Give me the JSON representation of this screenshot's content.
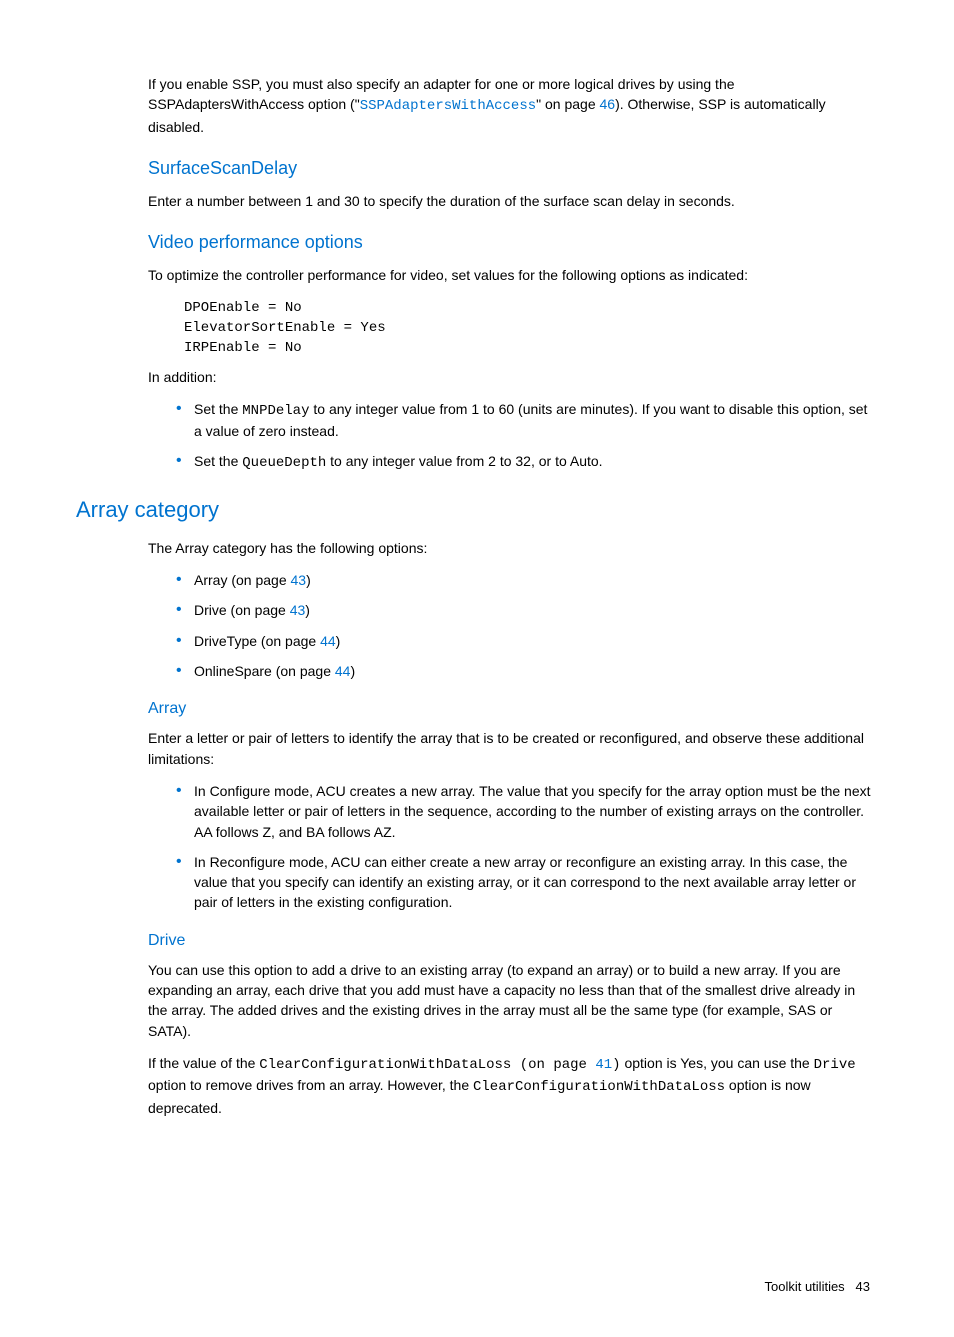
{
  "intro": {
    "p1a": "If you enable SSP, you must also specify an adapter for one or more logical drives by using the SSPAdaptersWithAccess option (\"",
    "link_text": "SSPAdaptersWithAccess",
    "p1b": "\" on page ",
    "link_page": "46",
    "p1c": "). Otherwise, SSP is automatically disabled."
  },
  "surfacescan": {
    "heading": "SurfaceScanDelay",
    "p": "Enter a number between 1 and 30 to specify the duration of the surface scan delay in seconds."
  },
  "video": {
    "heading": "Video performance options",
    "p1": "To optimize the controller performance for video, set values for the following options as indicated:",
    "code": "DPOEnable = No\nElevatorSortEnable = Yes\nIRPEnable = No",
    "p2": "In addition:",
    "bullets": [
      {
        "a": "Set the ",
        "code": "MNPDelay",
        "b": " to any integer value from 1 to 60 (units are minutes). If you want to disable this option, set a value of zero instead."
      },
      {
        "a": "Set the ",
        "code": "QueueDepth",
        "b": " to any integer value from 2 to 32, or to Auto."
      }
    ]
  },
  "arraycat": {
    "heading": "Array category",
    "p": "The Array category has the following options:",
    "items": [
      {
        "a": "Array (on page ",
        "page": "43",
        "b": ")"
      },
      {
        "a": "Drive (on page ",
        "page": "43",
        "b": ")"
      },
      {
        "a": "DriveType (on page ",
        "page": "44",
        "b": ")"
      },
      {
        "a": "OnlineSpare (on page ",
        "page": "44",
        "b": ")"
      }
    ]
  },
  "array": {
    "heading": "Array",
    "p": "Enter a letter or pair of letters to identify the array that is to be created or reconfigured, and observe these additional limitations:",
    "bullets": [
      "In Configure mode, ACU creates a new array. The value that you specify for the array option must be the next available letter or pair of letters in the sequence, according to the number of existing arrays on the controller. AA follows Z, and BA follows AZ.",
      "In Reconfigure mode, ACU can either create a new array or reconfigure an existing array. In this case, the value that you specify can identify an existing array, or it can correspond to the next available array letter or pair of letters in the existing configuration."
    ]
  },
  "drive": {
    "heading": "Drive",
    "p1": "You can use this option to add a drive to an existing array (to expand an array) or to build a new array. If you are expanding an array, each drive that you add must have a capacity no less than that of the smallest drive already in the array. The added drives and the existing drives in the array must all be the same type (for example, SAS or SATA).",
    "p2a": "If the value of the ",
    "code1a": "ClearConfigurationWithDataLoss (on page ",
    "link_page": "41",
    "code1b": ")",
    "p2b": " option is Yes, you can use the ",
    "code2": "Drive",
    "p2c": " option to remove drives from an array. However, the ",
    "code3": "ClearConfigurationWithDataLoss",
    "p2d": " option is now deprecated."
  },
  "footer": {
    "label": "Toolkit utilities",
    "page": "43"
  }
}
